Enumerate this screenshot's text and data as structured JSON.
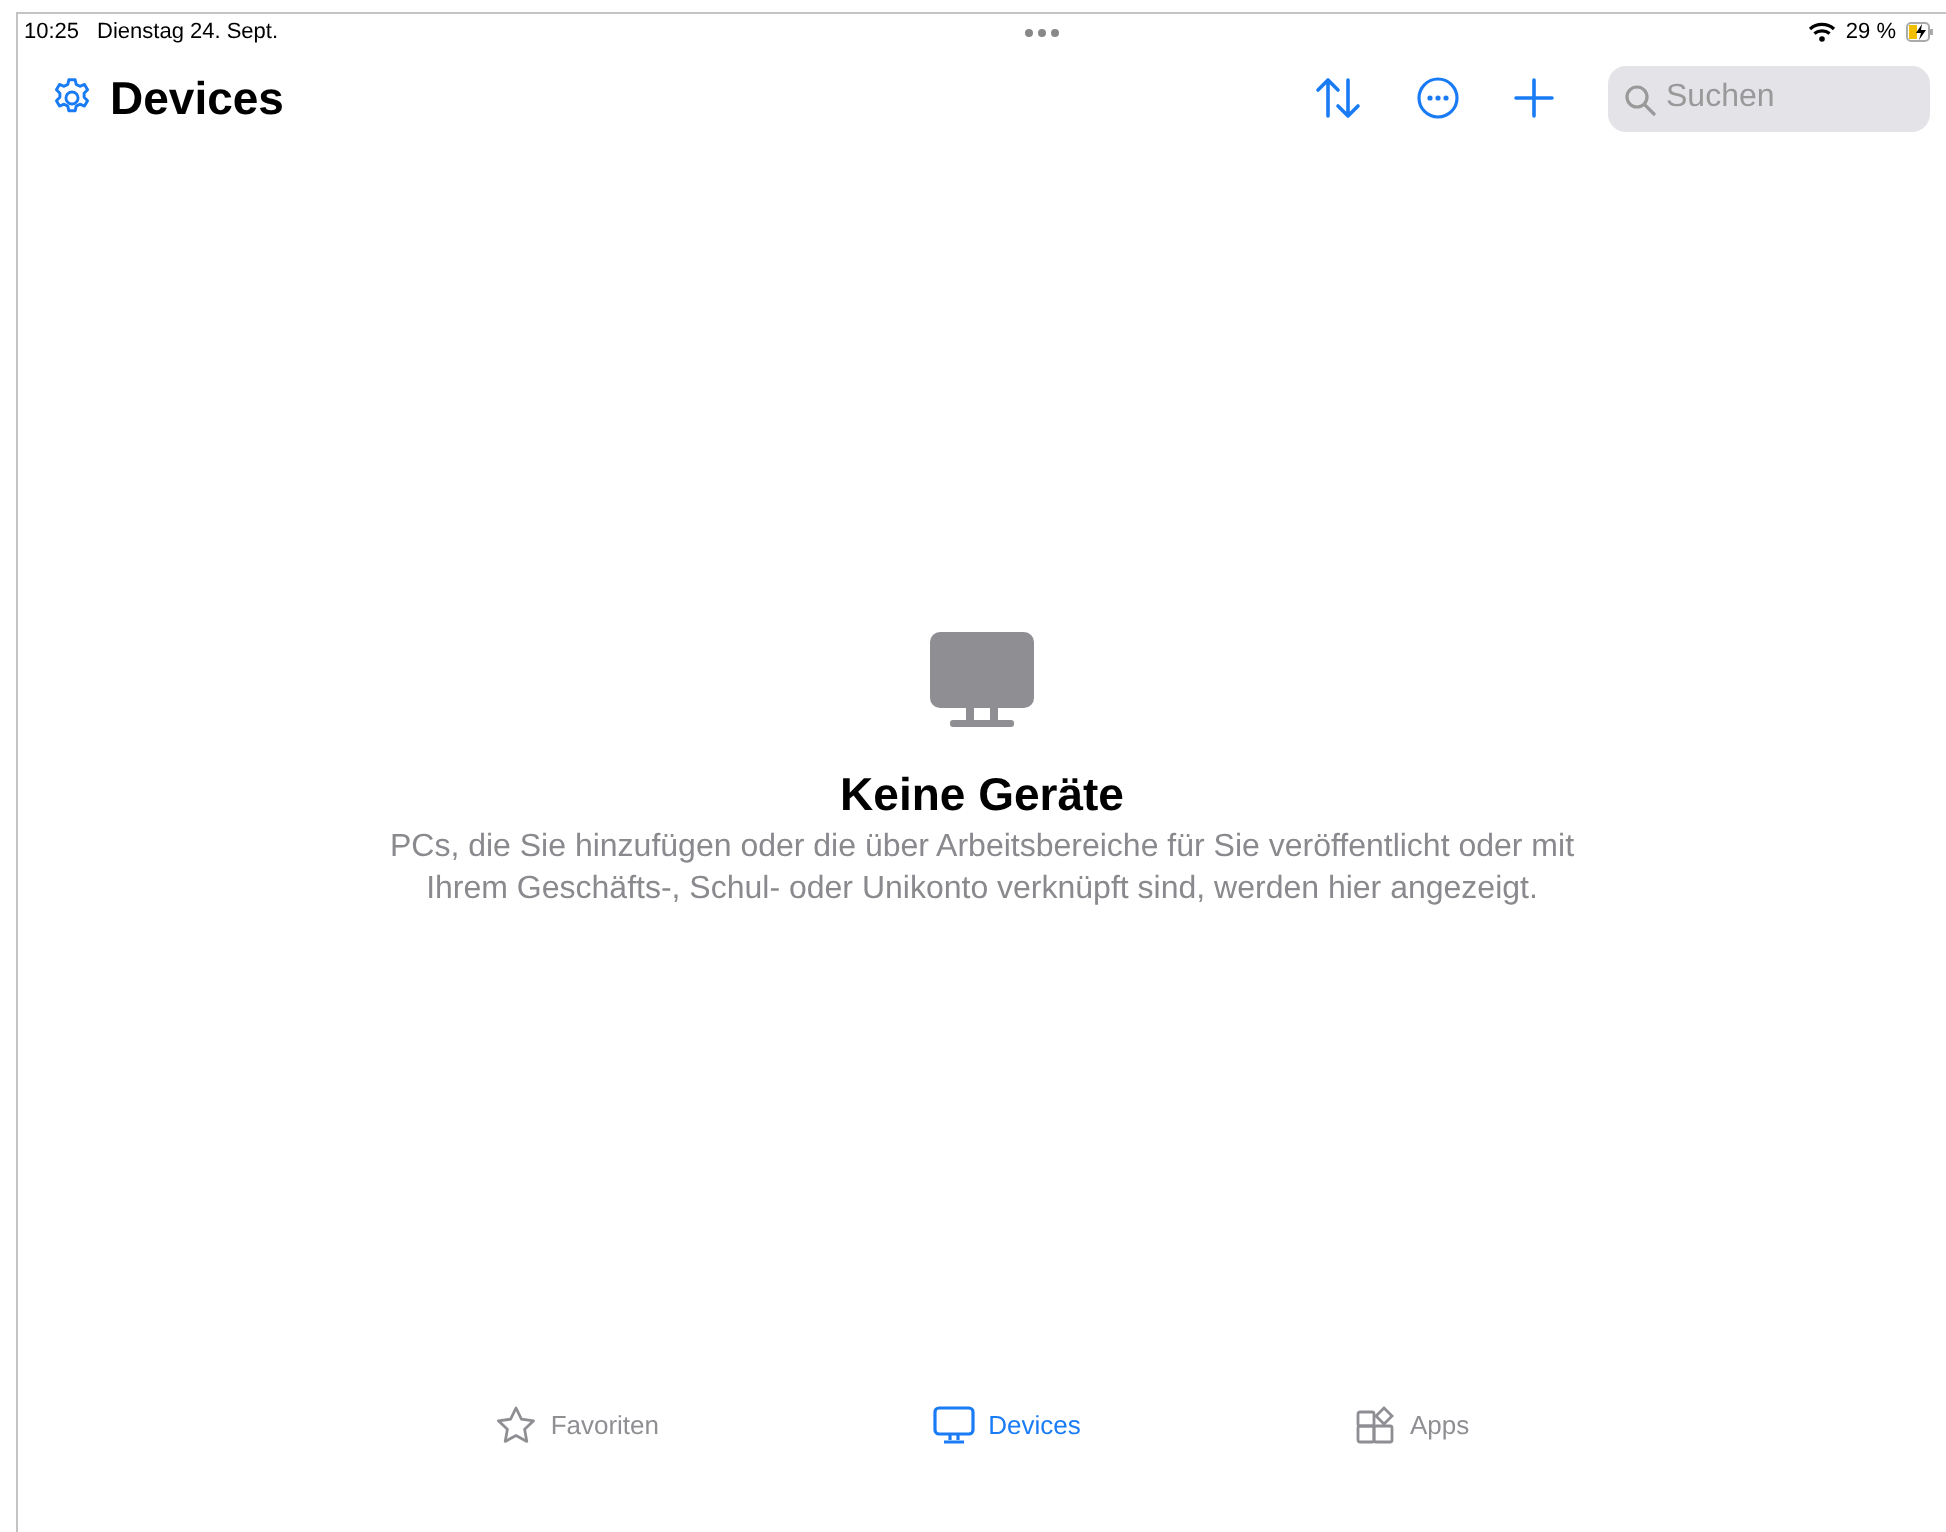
{
  "status_bar": {
    "time": "10:25",
    "date": "Dienstag 24. Sept.",
    "battery": "29 %"
  },
  "nav": {
    "title": "Devices",
    "search": {
      "placeholder": "Suchen"
    }
  },
  "empty_state": {
    "title": "Keine Geräte",
    "message": "PCs, die Sie hinzufügen oder die über Arbeitsbereiche für Sie veröffentlicht oder mit Ihrem Geschäfts-, Schul- oder Unikonto verknüpft sind, werden hier angezeigt."
  },
  "tabs": [
    {
      "label": "Favoriten",
      "kind": "star",
      "selected": false
    },
    {
      "label": "Devices",
      "kind": "monitor",
      "selected": true
    },
    {
      "label": "Apps",
      "kind": "apps",
      "selected": false
    }
  ]
}
